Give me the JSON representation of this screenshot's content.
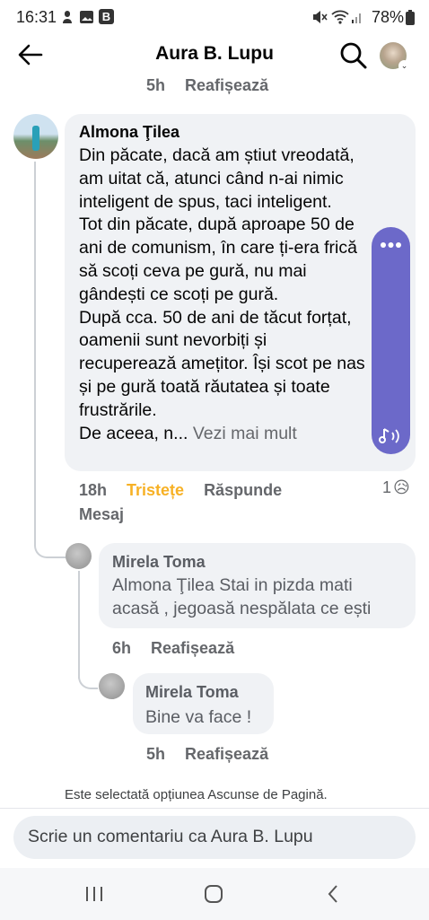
{
  "status_bar": {
    "time": "16:31",
    "battery": "78%",
    "badge": "B"
  },
  "header": {
    "title": "Aura B. Lupu",
    "back_icon": "arrow-left-icon",
    "search_icon": "search-icon"
  },
  "top_meta": {
    "time": "5h",
    "action": "Reafișează"
  },
  "comment": {
    "author": "Almona Ţilea",
    "lines": [
      "Din păcate, dacă am știut vreodată,",
      "am uitat că, atunci când n-ai nimic",
      "inteligent de spus, taci inteligent.",
      "Tot din păcate, după aproape 50 de",
      "ani de comunism, în care ți-era frică",
      "să scoți ceva pe gură, nu mai",
      "gândești ce scoți pe gură.",
      "După cca. 50 de ani de tăcut forțat,",
      "oamenii sunt nevorbiți și",
      "recuperează amețitor. Își scot pe nas",
      "și pe gură toată răutatea și toate",
      "frustrările."
    ],
    "last_line_prefix": "De aceea, n...",
    "see_more": "Vezi mai mult",
    "time": "18h",
    "reaction": "Tristețe",
    "reply": "Răspunde",
    "message": "Mesaj",
    "reaction_count": "1",
    "reaction_emoji": "😥",
    "reaction_color": "#f7b125"
  },
  "reply1": {
    "author": "Mirela Toma",
    "lines": [
      "Almona Ţilea Stai in pizda mati",
      "acasă , jegoasă nespălata ce ești"
    ],
    "time": "6h",
    "action": "Reafișează"
  },
  "reply2": {
    "author": "Mirela Toma",
    "text": "Bine va face !",
    "time": "5h",
    "action": "Reafișează"
  },
  "notice": "Este selectată opțiunea Ascunse de Pagină.",
  "input": {
    "placeholder": "Scrie un comentariu ca Aura B. Lupu"
  },
  "floating_widget": {
    "accent": "#6c69c9",
    "dots_icon": "more-dots-icon",
    "audio_icon": "audio-note-icon"
  },
  "nav": {
    "recents": "recents-icon",
    "home": "home-icon",
    "back": "back-icon"
  }
}
